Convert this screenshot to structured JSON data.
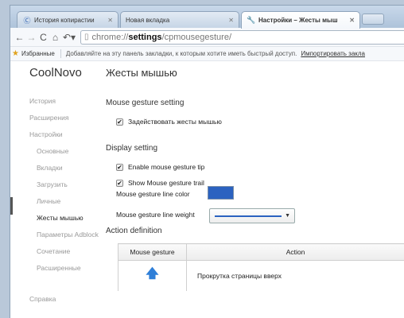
{
  "tabs": [
    {
      "label": "История копирастии",
      "icon": "coolnovo-icon",
      "active": false
    },
    {
      "label": "Новая вкладка",
      "icon": "",
      "active": false
    },
    {
      "label": "Настройки – Жесты мыш",
      "icon": "wrench-icon",
      "active": true
    }
  ],
  "address": {
    "scheme": "chrome://",
    "host": "settings",
    "path": "/cpmousegesture/"
  },
  "bookmarks": {
    "favorites_label": "Избранные",
    "message": "Добавляйте на эту панель закладки, к которым хотите иметь быстрый доступ.",
    "import_link": "Импортировать закла"
  },
  "sidebar": {
    "brand": "CoolNovo",
    "items": [
      {
        "label": "История"
      },
      {
        "label": "Расширения"
      },
      {
        "label": "Настройки"
      },
      {
        "label": "Основные"
      },
      {
        "label": "Вкладки"
      },
      {
        "label": "Загрузить"
      },
      {
        "label": "Личные"
      },
      {
        "label": "Жесты мышью"
      },
      {
        "label": "Параметры Adblock"
      },
      {
        "label": "Сочетание"
      },
      {
        "label": "Расширенные"
      },
      {
        "label": "Справка"
      }
    ]
  },
  "main": {
    "title": "Жесты мышью",
    "mouse_gesture_setting": {
      "heading": "Mouse gesture setting",
      "enable_label": "Задействовать жесты мышью",
      "enable_checked": true
    },
    "display_setting": {
      "heading": "Display setting",
      "tip_label": "Enable mouse gesture tip",
      "tip_checked": true,
      "trail_label": "Show Mouse gesture trail",
      "trail_checked": true,
      "color_label": "Mouse gesture line color",
      "line_color": "#2b62c0",
      "weight_label": "Mouse gesture line weight"
    },
    "action_definition": {
      "heading": "Action definition",
      "columns": [
        "Mouse gesture",
        "Action"
      ],
      "rows": [
        {
          "gesture_icon": "arrow-up-icon",
          "gesture_glyph": "🡅",
          "action": "Прокрутка страницы вверх"
        }
      ]
    }
  },
  "colors": {
    "gesture_arrow": "#2f7fd8",
    "tab_strip": "#b7cbe0"
  }
}
